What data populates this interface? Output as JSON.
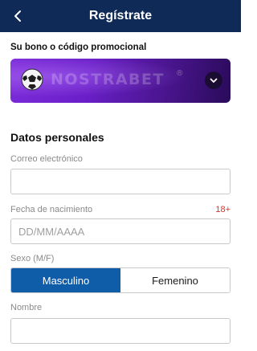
{
  "header": {
    "title": "Regístrate",
    "back_icon": "chevron-left-icon",
    "background_color": "#0f2a57"
  },
  "promo": {
    "label": "Su bono o código promocional",
    "brand": "NOSTRABET",
    "registered_mark": "®",
    "ball_icon": "soccer-ball-icon",
    "expand_icon": "chevron-down-icon",
    "accent_color": "#6a1fc9"
  },
  "personal": {
    "title": "Datos personales",
    "email": {
      "label": "Correo electrónico",
      "value": "",
      "placeholder": ""
    },
    "birthdate": {
      "label": "Fecha de nacimiento",
      "age_note": "18+",
      "value": "",
      "placeholder": "DD/MM/AAAA"
    },
    "sex": {
      "label": "Sexo (M/F)",
      "options": [
        "Masculino",
        "Femenino"
      ],
      "selected": "Masculino",
      "selected_color": "#0f5da8"
    },
    "name": {
      "label": "Nombre",
      "value": "",
      "placeholder": ""
    }
  }
}
